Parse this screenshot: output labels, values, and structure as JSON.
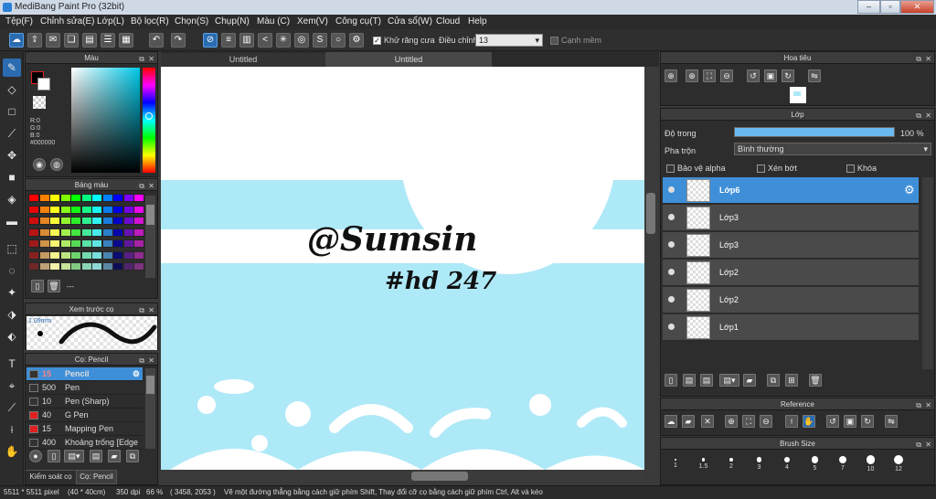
{
  "window": {
    "title": "MediBang Paint Pro (32bit)",
    "minimize": "–",
    "maximize": "▫",
    "close": "✕"
  },
  "menu": [
    "Tệp(F)",
    "Chỉnh sửa(E)",
    "Lớp(L)",
    "Bộ lọc(R)",
    "Chọn(S)",
    "Chụp(N)",
    "Màu (C)",
    "Xem(V)",
    "Công cụ(T)",
    "Cửa sổ(W)",
    "Cloud",
    "Help"
  ],
  "toolbar": {
    "antialias_label": "Khử răng cưa",
    "correction_label": "Điều chỉnh",
    "correction_value": "13",
    "eraser_label": "Cạnh mềm"
  },
  "tabs": [
    "Untitled",
    "Untitled"
  ],
  "color_panel": {
    "title": "Màu",
    "r": "R:0",
    "g": "G:0",
    "b": "B:0",
    "hex": "#000000"
  },
  "palette_panel": {
    "title": "Bảng màu",
    "footer": "---"
  },
  "preview_panel": {
    "title": "Xem trước cọ",
    "size": "1.09mm"
  },
  "brush_panel": {
    "title": "Cọ: Pencil",
    "brushes": [
      {
        "size": "15",
        "name": "Pencil",
        "color": "#333333"
      },
      {
        "size": "500",
        "name": "Pen",
        "color": "#333333"
      },
      {
        "size": "10",
        "name": "Pen (Sharp)",
        "color": "#333333"
      },
      {
        "size": "40",
        "name": "G Pen",
        "color": "#e02020"
      },
      {
        "size": "15",
        "name": "Mapping Pen",
        "color": "#e02020"
      },
      {
        "size": "400",
        "name": "Khoảng trống [Edge",
        "color": "#333333"
      }
    ]
  },
  "bottom_tabs": [
    "Kiểm soát cọ",
    "Cọ: Pencil"
  ],
  "navigator": {
    "title": "Hoa tiêu"
  },
  "layer_panel": {
    "title": "Lớp",
    "opacity_label": "Độ trong",
    "opacity_value": "100 %",
    "opacity": 100,
    "blend_label": "Pha trộn",
    "blend_value": "Bình thường",
    "protect_alpha": "Bảo vệ alpha",
    "clipping": "Xén bớt",
    "lock": "Khóa",
    "layers": [
      "Lớp6",
      "Lớp3",
      "Lớp3",
      "Lớp2",
      "Lớp2",
      "Lớp1"
    ]
  },
  "reference_panel": {
    "title": "Reference"
  },
  "brush_size_panel": {
    "title": "Brush Size",
    "sizes": [
      "1",
      "1.5",
      "2",
      "3",
      "4",
      "5",
      "7",
      "10",
      "12"
    ]
  },
  "canvas": {
    "text1": "@Sumsin",
    "text2": "#hd 247"
  },
  "status": {
    "size": "5511 * 5511 pixel",
    "dimensions": "(40 * 40cm)",
    "dpi": "350 dpi",
    "zoom": "66 %",
    "coords": "( 3458, 2053 )",
    "hint": "Vẽ một đường thẳng bằng cách giữ phím Shift, Thay đổi cỡ cọ bằng cách giữ phím Ctrl, Alt và kéo"
  },
  "colors": {
    "accent": "#2b6cb0",
    "canvas_blue": "#aee9f7",
    "selected_layer": "#3e8fd8"
  }
}
